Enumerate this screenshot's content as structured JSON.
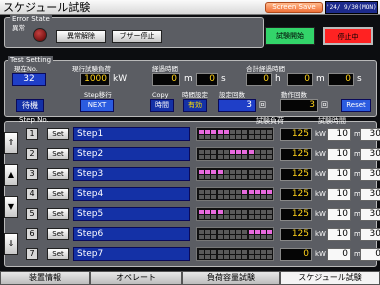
{
  "header": {
    "title": "スケジュール試験",
    "screensave_label": "Screen Save",
    "clock": "'24/ 9/30(MON) 16:51"
  },
  "error_state": {
    "title": "Error State",
    "status_label": "異常",
    "reset_label": "異常解除",
    "buzzer_label": "ブザー停止"
  },
  "controls": {
    "start_label": "試験開始",
    "stop_label": "停止中"
  },
  "test": {
    "title": "Test Setting",
    "current_no_label": "現在No.",
    "current_no": "32",
    "load_label": "現行試験負荷",
    "load_value": "1000",
    "load_unit": "kW",
    "elapsed_label": "経過時間",
    "elapsed_m": "0",
    "elapsed_s": "0",
    "unit_m": "m",
    "unit_s": "s",
    "unit_h": "h",
    "total_label": "合計経過時間",
    "total_h": "0",
    "total_m": "0",
    "total_s": "0",
    "standby_label": "待機",
    "step_move_label": "Step移行",
    "next_label": "NEXT",
    "copy_label": "Copy",
    "time_btn_label": "時間",
    "time_setting_label": "時間設定",
    "enable_label": "有効",
    "set_count_label": "設定回数",
    "set_count": "3",
    "run_count_label": "動作回数",
    "run_count": "3",
    "count_unit": "回",
    "reset_label": "Reset"
  },
  "steps_header": {
    "step_no": "Step No.",
    "load": "試験負荷",
    "time": "試験時間"
  },
  "set_label": "Set",
  "steps": [
    {
      "no": "1",
      "name": "Step1",
      "load": "125",
      "unit": "kW",
      "time_m": "10",
      "time_s": "30",
      "bar": [
        1,
        1,
        1,
        1,
        1,
        0,
        0,
        0,
        0,
        0,
        0,
        0
      ]
    },
    {
      "no": "2",
      "name": "Step2",
      "load": "125",
      "unit": "kW",
      "time_m": "10",
      "time_s": "30",
      "bar": [
        0,
        0,
        0,
        0,
        0,
        1,
        1,
        1,
        1,
        0,
        0,
        0
      ]
    },
    {
      "no": "3",
      "name": "Step3",
      "load": "125",
      "unit": "kW",
      "time_m": "10",
      "time_s": "30",
      "bar": [
        1,
        1,
        1,
        1,
        0,
        0,
        0,
        0,
        0,
        0,
        0,
        0
      ]
    },
    {
      "no": "4",
      "name": "Step4",
      "load": "125",
      "unit": "kW",
      "time_m": "10",
      "time_s": "30",
      "bar": [
        0,
        0,
        0,
        0,
        0,
        0,
        0,
        1,
        1,
        1,
        1,
        1
      ]
    },
    {
      "no": "5",
      "name": "Step5",
      "load": "125",
      "unit": "kW",
      "time_m": "10",
      "time_s": "30",
      "bar": [
        1,
        1,
        1,
        1,
        0,
        0,
        0,
        0,
        0,
        0,
        0,
        0
      ]
    },
    {
      "no": "6",
      "name": "Step6",
      "load": "125",
      "unit": "kW",
      "time_m": "10",
      "time_s": "30",
      "bar": [
        0,
        0,
        0,
        0,
        0,
        0,
        0,
        0,
        1,
        1,
        1,
        1
      ]
    },
    {
      "no": "7",
      "name": "Step7",
      "load": "0",
      "unit": "kW",
      "time_m": "0",
      "time_s": "0",
      "bar": [
        0,
        0,
        0,
        0,
        0,
        0,
        0,
        0,
        0,
        0,
        0,
        0
      ]
    }
  ],
  "nav": {
    "top": "⇑",
    "up": "▲",
    "down": "▼",
    "bottom": "⇓"
  },
  "tabs": [
    {
      "label": "装置情報"
    },
    {
      "label": "オペレート"
    },
    {
      "label": "負荷容量試験"
    },
    {
      "label": "スケジュール試験"
    }
  ],
  "colors": {
    "bar_on": "#e86adf",
    "bar_off": "#5a5a5a",
    "accent_blue": "#1431a6",
    "stop_red": "#ff2222",
    "start_green": "#33d46a"
  }
}
